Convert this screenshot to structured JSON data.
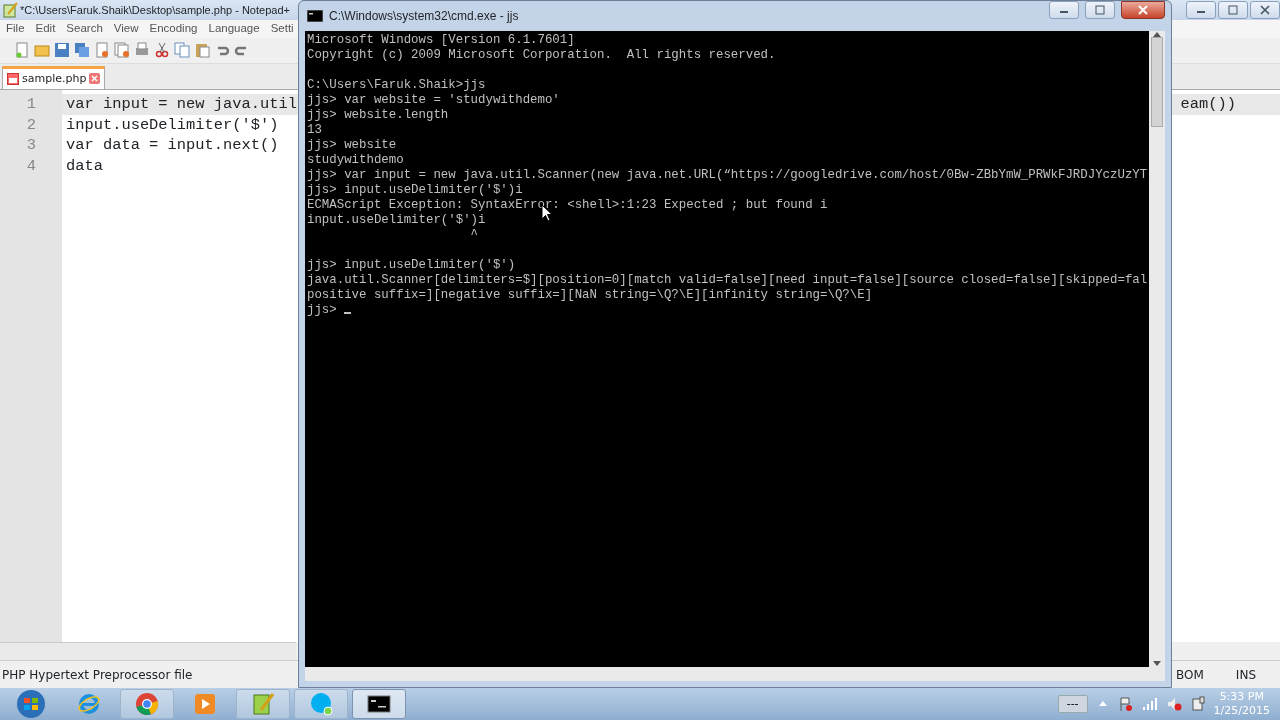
{
  "notepad": {
    "title": "*C:\\Users\\Faruk.Shaik\\Desktop\\sample.php - Notepad+",
    "menu": [
      "File",
      "Edit",
      "Search",
      "View",
      "Encoding",
      "Language",
      "Setti"
    ],
    "tabs": [
      {
        "label": "sample.php",
        "selected": true
      }
    ],
    "lines": [
      {
        "number": "1",
        "text": "var input = new java.util",
        "current": true
      },
      {
        "number": "2",
        "text": "input.useDelimiter('$')",
        "current": false
      },
      {
        "number": "3",
        "text": "var data = input.next()",
        "current": false
      },
      {
        "number": "4",
        "text": "data",
        "current": false
      }
    ],
    "line_1_tail": "eam())",
    "status": {
      "file_type": "PHP Hypertext Preprocessor file",
      "encoding": "BOM",
      "mode": "INS"
    }
  },
  "console": {
    "title": "C:\\Windows\\system32\\cmd.exe - jjs",
    "blocks": [
      [
        "Microsoft Windows [Version 6.1.7601]",
        "Copyright (c) 2009 Microsoft Corporation.  All rights reserved."
      ],
      [
        "C:\\Users\\Faruk.Shaik>jjs",
        "jjs> var website = 'studywithdemo'",
        "jjs> website.length",
        "13",
        "jjs> website",
        "studywithdemo",
        "jjs> var input = new java.util.Scanner(new java.net.URL(“https://googledrive.com/host/0Bw-ZBbYmW_PRWkFJRDJYczUzYT",
        "jjs> input.useDelimiter('$')i",
        "ECMAScript Exception: SyntaxError: <shell>:1:23 Expected ; but found i",
        "input.useDelimiter('$')i",
        "                      ^"
      ],
      [
        "jjs> input.useDelimiter('$')",
        "java.util.Scanner[delimiters=$][position=0][match valid=false][need input=false][source closed=false][skipped=fal",
        "positive suffix=][negative suffix=][NaN string=\\Q?\\E][infinity string=\\Q?\\E]",
        "jjs> "
      ]
    ]
  },
  "taskbar": {
    "apps": [
      {
        "kind": "ie",
        "selected": false
      },
      {
        "kind": "chrome",
        "selected": false
      },
      {
        "kind": "media",
        "selected": false
      },
      {
        "kind": "notepad",
        "selected": false
      },
      {
        "kind": "skype",
        "selected": false
      },
      {
        "kind": "cmd",
        "selected": true
      }
    ],
    "battery": "---",
    "time": "5:33 PM",
    "date": "1/25/2015"
  }
}
